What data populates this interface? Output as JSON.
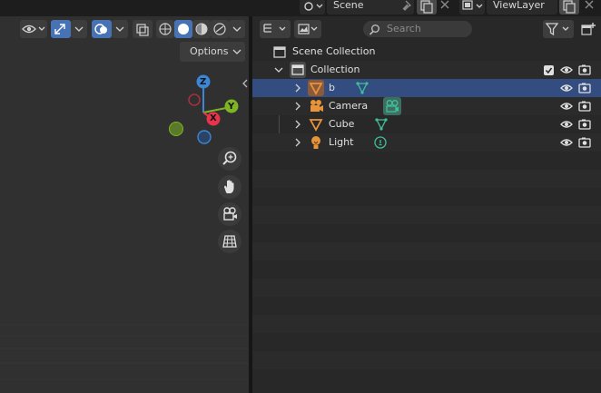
{
  "topbar": {
    "scene_label": "Scene",
    "viewlayer_label": "ViewLayer"
  },
  "viewport": {
    "options_label": "Options",
    "gizmo": {
      "x_label": "X",
      "y_label": "Y",
      "z_label": "Z"
    }
  },
  "outliner": {
    "search_placeholder": "Search",
    "scene_collection_label": "Scene Collection",
    "collection_label": "Collection",
    "items": [
      {
        "label": "b",
        "selected": true
      },
      {
        "label": "Camera"
      },
      {
        "label": "Cube"
      },
      {
        "label": "Light"
      }
    ]
  },
  "colors": {
    "selection": "#334d80",
    "accent_blue": "#4772b3",
    "object_orange": "#e8943a",
    "data_green": "#3fbf9a",
    "axis_x": "#e8334d",
    "axis_y": "#7fb524",
    "axis_z": "#3b86d6"
  }
}
